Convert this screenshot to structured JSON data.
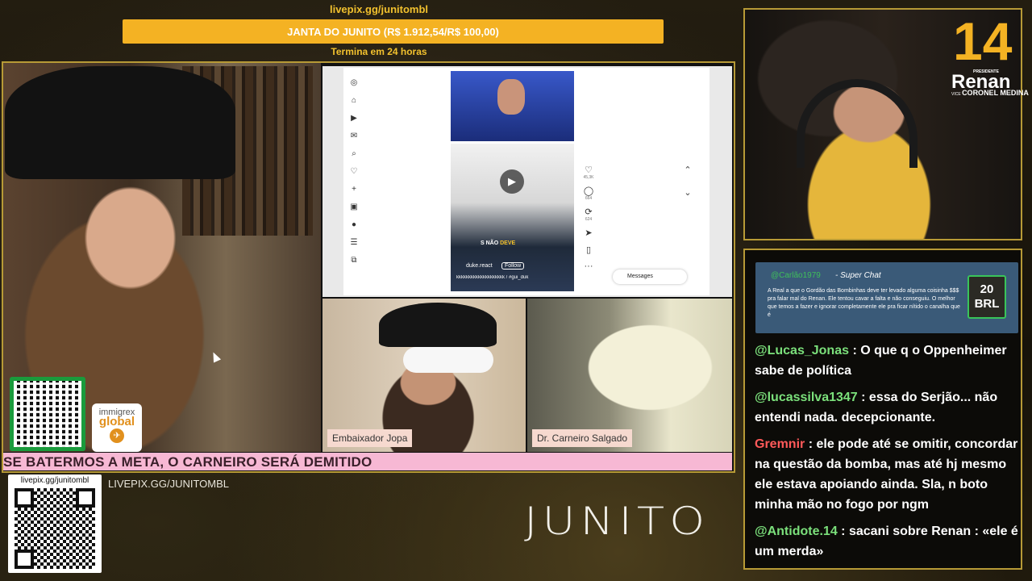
{
  "goal": {
    "url": "livepix.gg/junitombl",
    "title": "JANTA DO JUNITO (R$ 1.912,54/R$ 100,00)",
    "time_left": "Termina em 24 horas",
    "color": "#f4b223"
  },
  "host_overlay": {
    "sponsor_line1": "immigrex",
    "sponsor_line2": "global",
    "sponsor_icon": "airplane-icon"
  },
  "screenshare": {
    "caption_prefix": "S NÃO",
    "caption_highlight": "DEVE",
    "handle": "duke.react",
    "follow_label": "Follow",
    "comment": "kkkkkkkkkkkkkkkkkkkk / #gui_duk",
    "actions": [
      {
        "icon": "heart-icon",
        "count": "45,3K"
      },
      {
        "icon": "comment-icon",
        "count": "664"
      },
      {
        "icon": "repost-icon",
        "count": "624"
      },
      {
        "icon": "share-icon",
        "count": ""
      },
      {
        "icon": "bookmark-icon",
        "count": ""
      },
      {
        "icon": "more-icon",
        "count": ""
      }
    ],
    "messages_label": "Messages"
  },
  "guests": {
    "left_name": "Embaixador Jopa",
    "right_name": "Dr. Carneiro Salgado"
  },
  "ticker": "SE BATERMOS A META, O CARNEIRO SERÁ DEMITIDO",
  "bottom": {
    "qr_label": "livepix.gg/junitombl",
    "livepix": "LIVEPIX.GG/JUNITOMBL",
    "brand": "JUNITO"
  },
  "renan_badge": {
    "number": "14",
    "pres": "PRESIDENTE",
    "name": "Renan",
    "vice_prefix": "VICE",
    "vice_name": "CORONEL MEDINA"
  },
  "superchat": {
    "user": "@Carlão1979",
    "label": "- Super Chat",
    "message": "A Real a que o Gordão das Bombinhas deve ter levado alguma coisinha $$$ pra falar mal do Renan. Ele tentou cavar a falta e não conseguiu. O melhor que temos a fazer e ignorar completamente ele pra ficar nítido o canalha que é",
    "amount": "20",
    "currency": "BRL"
  },
  "chat": [
    {
      "user": "@Lucas_Jonas",
      "color": "#7be07b",
      "text": ": O que q o Oppenheimer sabe de política"
    },
    {
      "user": "@lucassilva1347",
      "color": "#7be07b",
      "text": ": essa do Serjão... não entendi nada. decepcionante."
    },
    {
      "user": "Gremnir",
      "color": "#ff5a5a",
      "text": ": ele pode até se omitir, concordar na questão da bomba, mas até hj mesmo ele estava apoiando ainda. Sla, n boto minha mão no fogo por ngm"
    },
    {
      "user": "@Antidote.14",
      "color": "#7be07b",
      "text": ": sacani sobre Renan : «ele é um merda»"
    }
  ]
}
